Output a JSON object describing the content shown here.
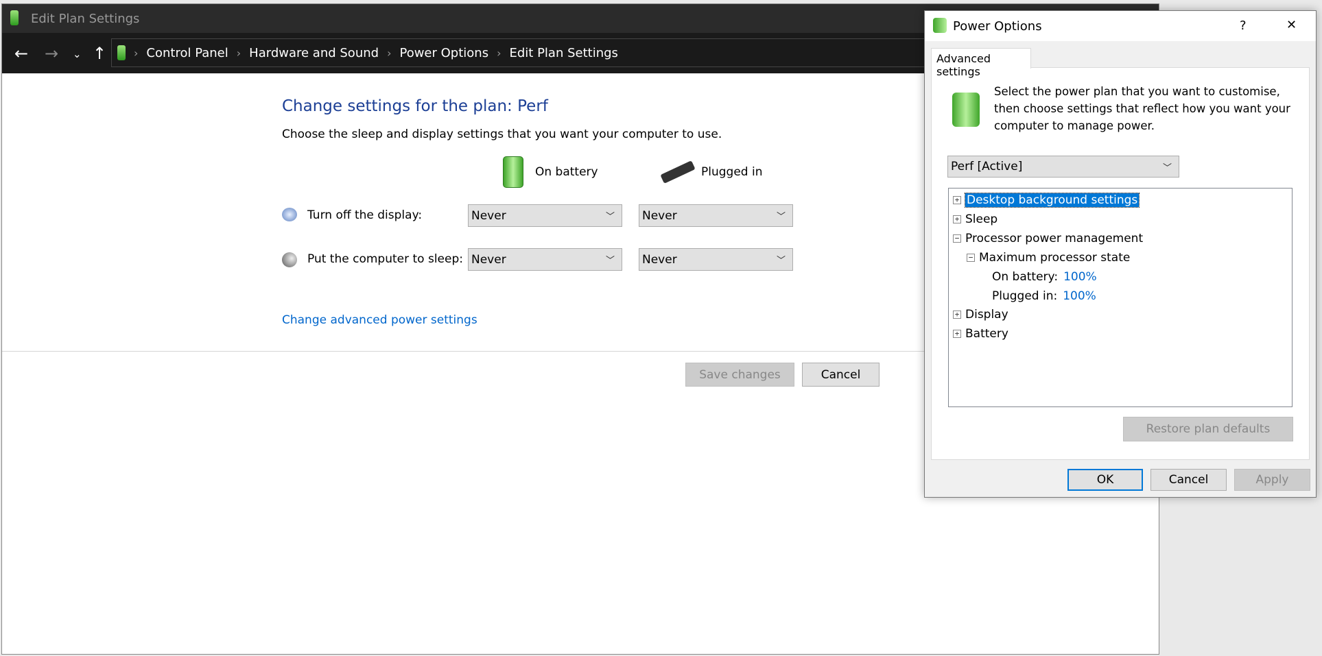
{
  "main_window": {
    "title": "Edit Plan Settings",
    "breadcrumb": [
      "Control Panel",
      "Hardware and Sound",
      "Power Options",
      "Edit Plan Settings"
    ],
    "heading": "Change settings for the plan: Perf",
    "subheading": "Choose the sleep and display settings that you want your computer to use.",
    "columns": {
      "battery": "On battery",
      "plugged": "Plugged in"
    },
    "rows": [
      {
        "label": "Turn off the display:",
        "battery": "Never",
        "plugged": "Never",
        "icon": "display-clock-icon"
      },
      {
        "label": "Put the computer to sleep:",
        "battery": "Never",
        "plugged": "Never",
        "icon": "moon-icon"
      }
    ],
    "advanced_link": "Change advanced power settings",
    "save_label": "Save changes",
    "cancel_label": "Cancel"
  },
  "dialog": {
    "title": "Power Options",
    "help": "?",
    "close": "✕",
    "tab": "Advanced settings",
    "description": "Select the power plan that you want to customise, then choose settings that reflect how you want your computer to manage power.",
    "plan": "Perf [Active]",
    "tree": [
      {
        "label": "Desktop background settings",
        "expander": "+",
        "selected": true
      },
      {
        "label": "Sleep",
        "expander": "+"
      },
      {
        "label": "Processor power management",
        "expander": "−"
      },
      {
        "label": "Maximum processor state",
        "expander": "−"
      },
      {
        "label": "On battery:",
        "value": "100%"
      },
      {
        "label": "Plugged in:",
        "value": "100%"
      },
      {
        "label": "Display",
        "expander": "+"
      },
      {
        "label": "Battery",
        "expander": "+"
      }
    ],
    "restore_label": "Restore plan defaults",
    "ok_label": "OK",
    "cancel_label": "Cancel",
    "apply_label": "Apply"
  },
  "colors": {
    "accent": "#0078d7",
    "link": "#0066cc",
    "heading": "#1c3f95"
  }
}
